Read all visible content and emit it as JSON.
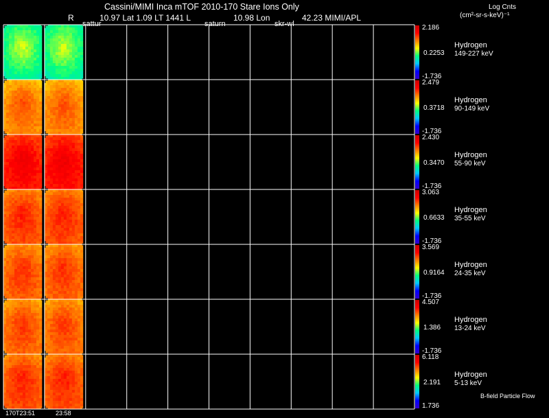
{
  "header": {
    "title": "Cassini/MIMI Inca mTOF  2010-170   Stare   Ions Only",
    "r_label": "R",
    "position_line": "10.97 Lat 1.09 LT 1441 L",
    "lon_line": "10.98 Lon",
    "sun_line": "42.23  MIMI/APL",
    "marker_left": "sattur",
    "marker_mid": "saturn",
    "marker_right": "skr-wl",
    "units_line1": "Log Cnts",
    "units_line2": "(cm²-sr-s-keV)⁻¹"
  },
  "footer": {
    "time_start": "170T23:51",
    "time_end": "23:58",
    "bfield_label": "B-field Particle Flow"
  },
  "chart_data": {
    "type": "heatmap",
    "title": "Cassini/MIMI Inca mTOF  2010-170   Stare   Ions Only",
    "columns": 10,
    "filled_columns": 2,
    "colormap": [
      "#3300cc",
      "#0000ff",
      "#00c8ff",
      "#00ff80",
      "#ffff00",
      "#ff8000",
      "#ff0000",
      "#cc0000"
    ],
    "panels": [
      {
        "species": "Hydrogen",
        "energy": "149-227 keV",
        "max": "2.186",
        "mid": "0.2253",
        "min": "-1.736",
        "level": 0.55
      },
      {
        "species": "Hydrogen",
        "energy": "90-149 keV",
        "max": "2.479",
        "mid": "0.3718",
        "min": "-1.736",
        "level": 0.74
      },
      {
        "species": "Hydrogen",
        "energy": "55-90 keV",
        "max": "2.430",
        "mid": "0.3470",
        "min": "-1.736",
        "level": 0.87
      },
      {
        "species": "Hydrogen",
        "energy": "35-55 keV",
        "max": "3.063",
        "mid": "0.6633",
        "min": "-1.736",
        "level": 0.8
      },
      {
        "species": "Hydrogen",
        "energy": "24-35 keV",
        "max": "3.569",
        "mid": "0.9164",
        "min": "-1.736",
        "level": 0.78
      },
      {
        "species": "Hydrogen",
        "energy": "13-24 keV",
        "max": "4.507",
        "mid": "1.386",
        "min": "-1.736",
        "level": 0.77
      },
      {
        "species": "Hydrogen",
        "energy": "5-13 keV",
        "max": "6.118",
        "mid": "2.191",
        "min": "1.736",
        "level": 0.8
      }
    ]
  }
}
